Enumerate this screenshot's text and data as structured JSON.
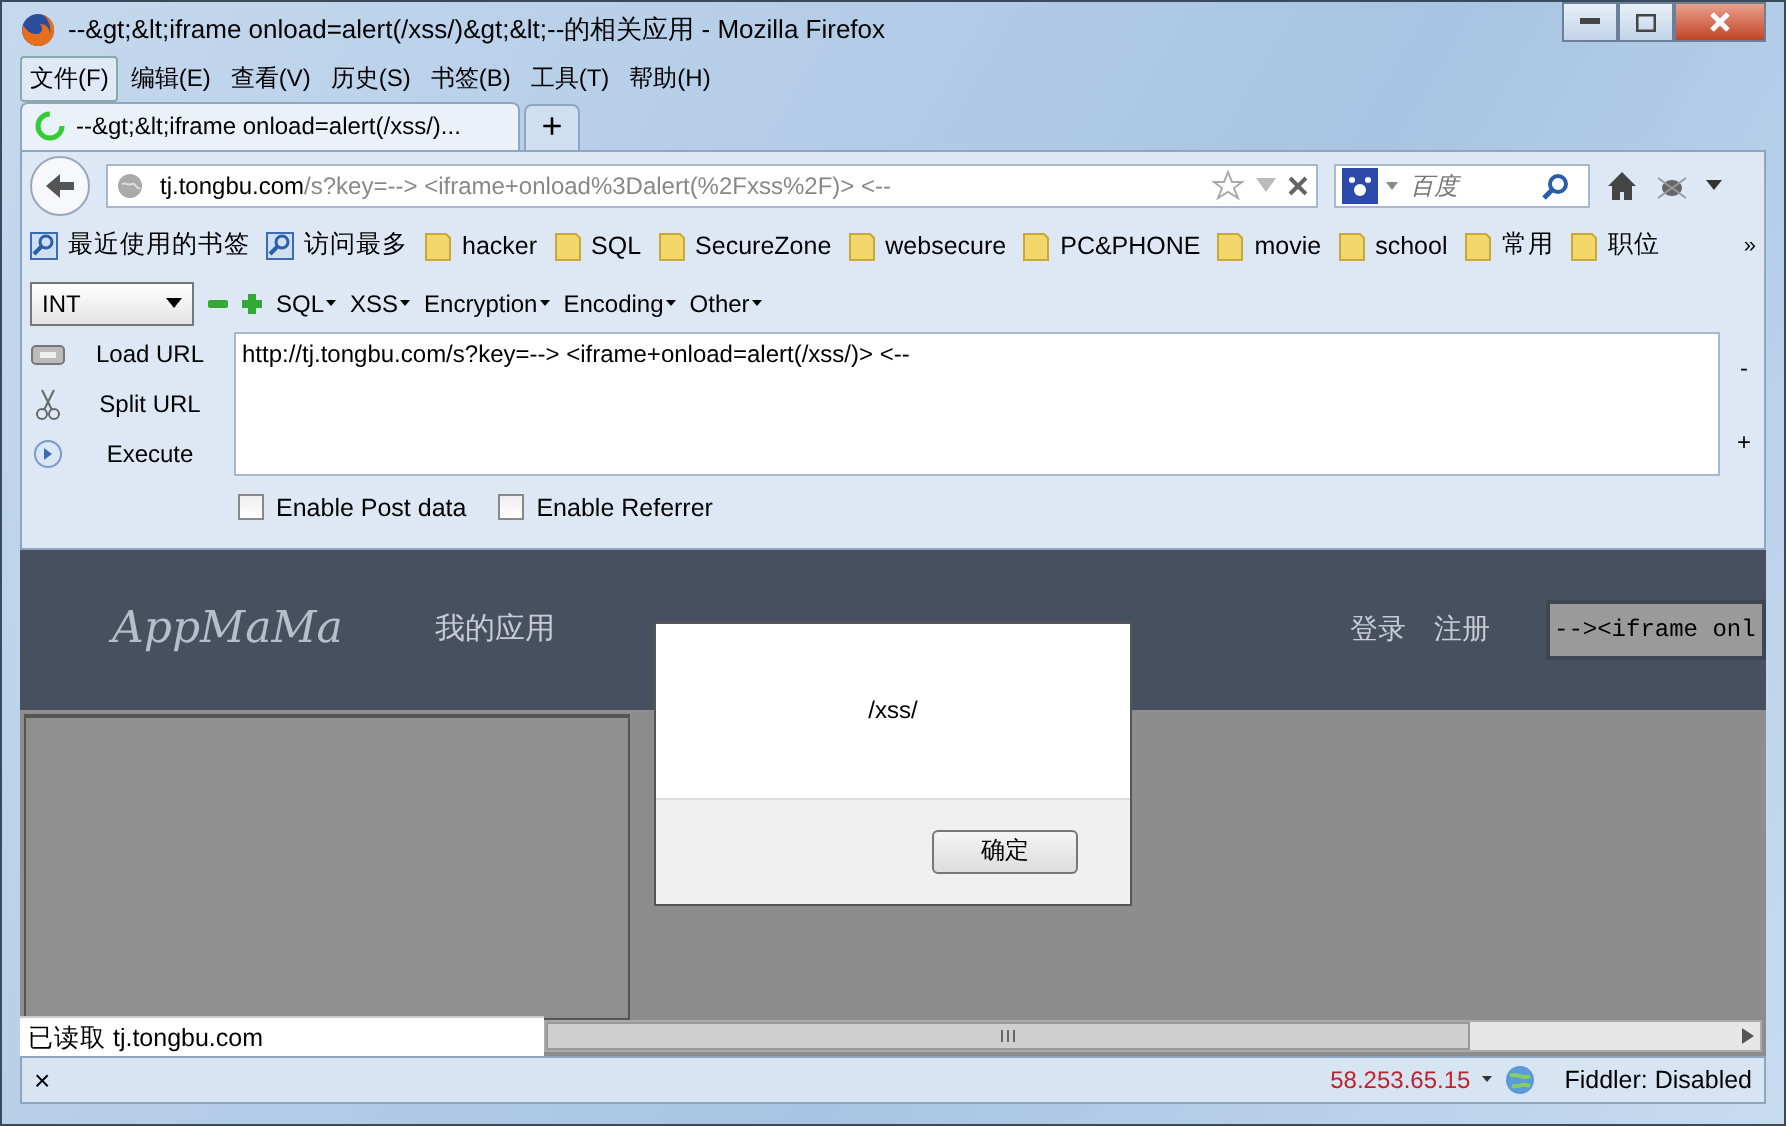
{
  "window": {
    "title": "--&gt;&lt;iframe onload=alert(/xss/)&gt;&lt;--的相关应用 - Mozilla Firefox"
  },
  "menu": [
    {
      "label": "文件(F)",
      "selected": true
    },
    {
      "label": "编辑(E)",
      "selected": false
    },
    {
      "label": "查看(V)",
      "selected": false
    },
    {
      "label": "历史(S)",
      "selected": false
    },
    {
      "label": "书签(B)",
      "selected": false
    },
    {
      "label": "工具(T)",
      "selected": false
    },
    {
      "label": "帮助(H)",
      "selected": false
    }
  ],
  "tabs": [
    {
      "label": "--&gt;&lt;iframe onload=alert(/xss/)...",
      "selected": true
    }
  ],
  "new_tab": "+",
  "nav": {
    "url_host": "tj.tongbu.com",
    "url_rest": "/s?key=--> <iframe+onload%3Dalert(%2Fxss%2F)> <--",
    "search_placeholder": "百度"
  },
  "bookmarks": [
    {
      "label": "最近使用的书签",
      "kind": "smart"
    },
    {
      "label": "访问最多",
      "kind": "smart"
    },
    {
      "label": "hacker",
      "kind": "folder"
    },
    {
      "label": "SQL",
      "kind": "folder"
    },
    {
      "label": "SecureZone",
      "kind": "folder"
    },
    {
      "label": "websecure",
      "kind": "folder"
    },
    {
      "label": "PC&PHONE",
      "kind": "folder"
    },
    {
      "label": "movie",
      "kind": "folder"
    },
    {
      "label": "school",
      "kind": "folder"
    },
    {
      "label": "常用",
      "kind": "folder"
    },
    {
      "label": "职位",
      "kind": "folder"
    }
  ],
  "bookmarks_more": "»",
  "hackbar": {
    "mode": "INT",
    "menus": [
      "SQL",
      "XSS",
      "Encryption",
      "Encoding",
      "Other"
    ],
    "actions": [
      {
        "label": "Load URL",
        "kind": "load"
      },
      {
        "label": "Split URL",
        "kind": "split"
      },
      {
        "label": "Execute",
        "kind": "execute"
      }
    ],
    "url": "http://tj.tongbu.com/s?key=--> <iframe+onload=alert(/xss/)> <--",
    "side": [
      "-",
      "+"
    ],
    "checkboxes": [
      {
        "label": "Enable Post data",
        "checked": false
      },
      {
        "label": "Enable Referrer",
        "checked": false
      }
    ]
  },
  "page": {
    "logo": "AppMaMa",
    "nav": [
      "我的应用"
    ],
    "links": [
      "登录",
      "注册"
    ],
    "search_value": "--><iframe onl"
  },
  "dialog": {
    "message": "/xss/",
    "button": "确定"
  },
  "status": {
    "overlay": "已读取 tj.tongbu.com",
    "close": "×",
    "ip": "58.253.65.15",
    "fiddler": "Fiddler: Disabled"
  }
}
